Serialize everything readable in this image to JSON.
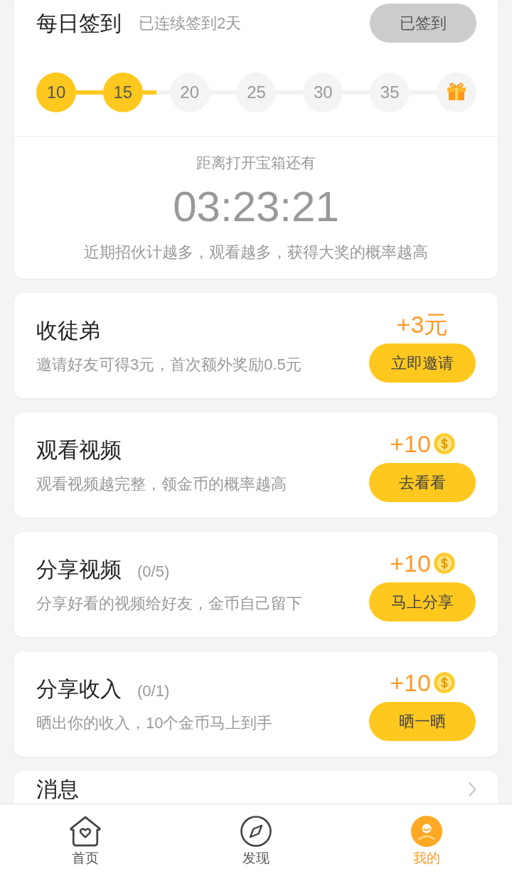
{
  "signin": {
    "title": "每日签到",
    "streak": "已连续签到2天",
    "button": {
      "label": "已签到",
      "disabled": true
    },
    "days": [
      {
        "kind": "day",
        "label": "10",
        "done": true
      },
      {
        "kind": "day",
        "label": "15",
        "done": true
      },
      {
        "kind": "day",
        "label": "20",
        "done": false
      },
      {
        "kind": "day",
        "label": "25",
        "done": false
      },
      {
        "kind": "day",
        "label": "30",
        "done": false
      },
      {
        "kind": "day",
        "label": "35",
        "done": false
      },
      {
        "kind": "gift",
        "done": false
      }
    ]
  },
  "chest": {
    "label": "距离打开宝箱还有",
    "countdown": "03:23:21",
    "hint": "近期招伙计越多，观看越多，获得大奖的概率越高"
  },
  "tasks": [
    {
      "title": "收徒弟",
      "description": "邀请好友可得3元，首次额外奖励0.5元",
      "reward": "+3元",
      "coin": false,
      "button": "立即邀请"
    },
    {
      "title": "观看视频",
      "description": "观看视频越完整，领金币的概率越高",
      "reward": "+10",
      "coin": true,
      "button": "去看看"
    },
    {
      "title": "分享视频",
      "count": "(0/5)",
      "description": "分享好看的视频给好友，金币自己留下",
      "reward": "+10",
      "coin": true,
      "button": "马上分享"
    },
    {
      "title": "分享收入",
      "count": "(0/1)",
      "description": "晒出你的收入，10个金币马上到手",
      "reward": "+10",
      "coin": true,
      "button": "晒一晒"
    }
  ],
  "message_row": {
    "title": "消息"
  },
  "tab_bar": [
    {
      "kind": "home",
      "label": "首页",
      "selected": false
    },
    {
      "kind": "discover",
      "label": "发现",
      "selected": false
    },
    {
      "kind": "me",
      "label": "我的",
      "selected": true
    }
  ]
}
